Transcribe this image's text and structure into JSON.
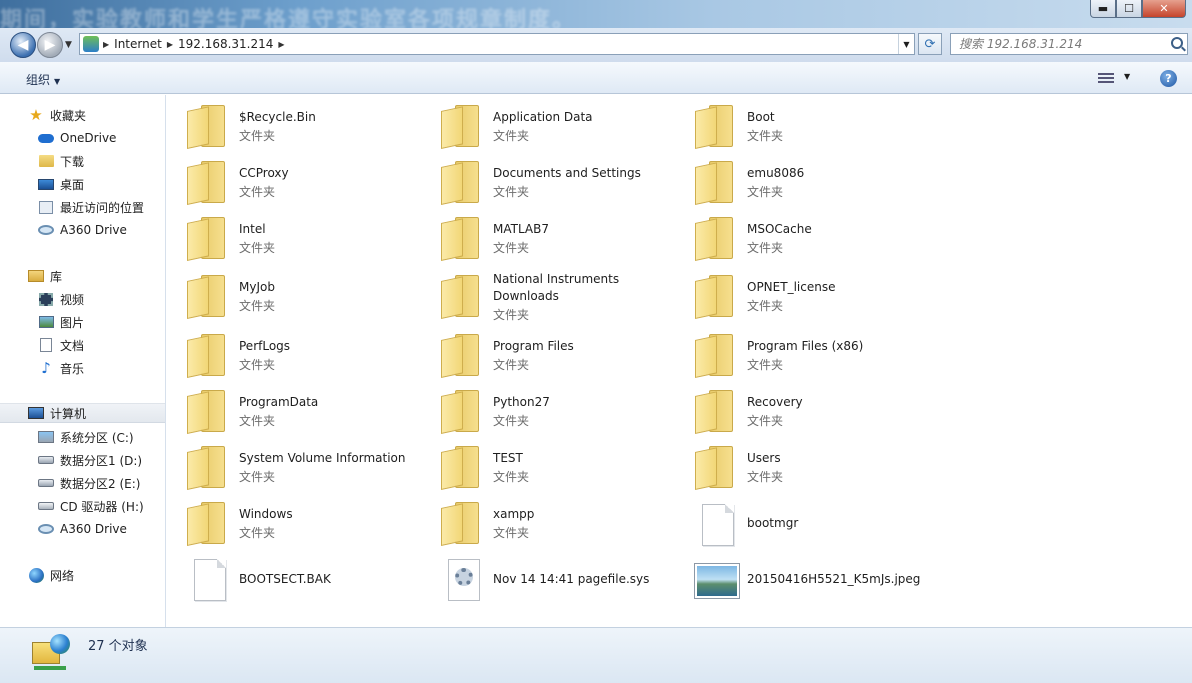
{
  "window": {
    "ghost_title": "期间，实验教师和学生严格遵守实验室各项规章制度。",
    "min_label": "▬",
    "max_label": "☐",
    "close_label": "✕"
  },
  "address": {
    "crumbs": [
      "Internet",
      "192.168.31.214"
    ],
    "search_placeholder": "搜索 192.168.31.214"
  },
  "toolbar": {
    "organize_label": "组织"
  },
  "nav": {
    "favorites": "收藏夹",
    "onedrive": "OneDrive",
    "downloads": "下载",
    "desktop": "桌面",
    "recent": "最近访问的位置",
    "a360": "A360 Drive",
    "libraries": "库",
    "videos": "视频",
    "pictures": "图片",
    "documents": "文档",
    "music": "音乐",
    "computer": "计算机",
    "drive_c": "系统分区 (C:)",
    "drive_d": "数据分区1 (D:)",
    "drive_e": "数据分区2 (E:)",
    "drive_h": "CD 驱动器 (H:)",
    "a360_2": "A360 Drive",
    "network": "网络"
  },
  "items": [
    {
      "name": "$Recycle.Bin",
      "type": "文件夹"
    },
    {
      "name": "Application Data",
      "type": "文件夹"
    },
    {
      "name": "Boot",
      "type": "文件夹"
    },
    {
      "name": "CCProxy",
      "type": "文件夹"
    },
    {
      "name": "Documents and Settings",
      "type": "文件夹"
    },
    {
      "name": "emu8086",
      "type": "文件夹"
    },
    {
      "name": "Intel",
      "type": "文件夹"
    },
    {
      "name": "MATLAB7",
      "type": "文件夹"
    },
    {
      "name": "MSOCache",
      "type": "文件夹"
    },
    {
      "name": "MyJob",
      "type": "文件夹"
    },
    {
      "name": "National Instruments Downloads",
      "type": "文件夹"
    },
    {
      "name": "OPNET_license",
      "type": "文件夹"
    },
    {
      "name": "PerfLogs",
      "type": "文件夹"
    },
    {
      "name": "Program Files",
      "type": "文件夹"
    },
    {
      "name": "Program Files (x86)",
      "type": "文件夹"
    },
    {
      "name": "ProgramData",
      "type": "文件夹"
    },
    {
      "name": "Python27",
      "type": "文件夹"
    },
    {
      "name": "Recovery",
      "type": "文件夹"
    },
    {
      "name": "System Volume Information",
      "type": "文件夹"
    },
    {
      "name": "TEST",
      "type": "文件夹"
    },
    {
      "name": "Users",
      "type": "文件夹"
    },
    {
      "name": "Windows",
      "type": "文件夹"
    },
    {
      "name": "xampp",
      "type": "文件夹"
    },
    {
      "name": "bootmgr",
      "type": ""
    },
    {
      "name": "BOOTSECT.BAK",
      "type": ""
    },
    {
      "name": "Nov 14 14:41 pagefile.sys",
      "type": ""
    },
    {
      "name": "20150416H5521_K5mJs.jpeg",
      "type": ""
    }
  ],
  "status": {
    "count_text": "27 个对象"
  }
}
